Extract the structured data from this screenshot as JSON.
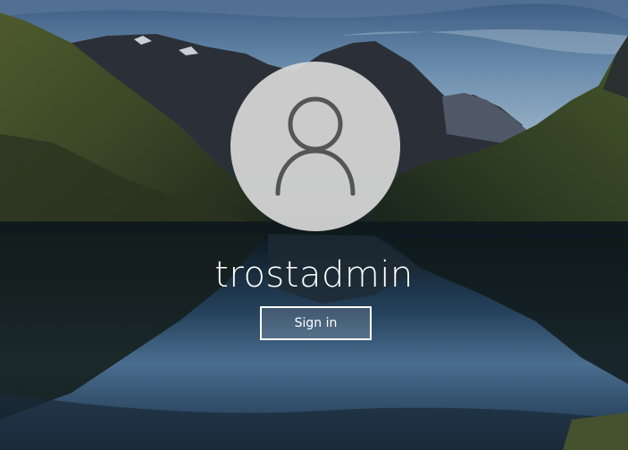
{
  "user": {
    "name": "trostadmin",
    "avatar_icon": "user-silhouette-icon"
  },
  "actions": {
    "sign_in_label": "Sign in"
  },
  "colors": {
    "text": "#ffffff",
    "avatar_bg": "#d7d7d7",
    "avatar_icon": "#555555"
  }
}
